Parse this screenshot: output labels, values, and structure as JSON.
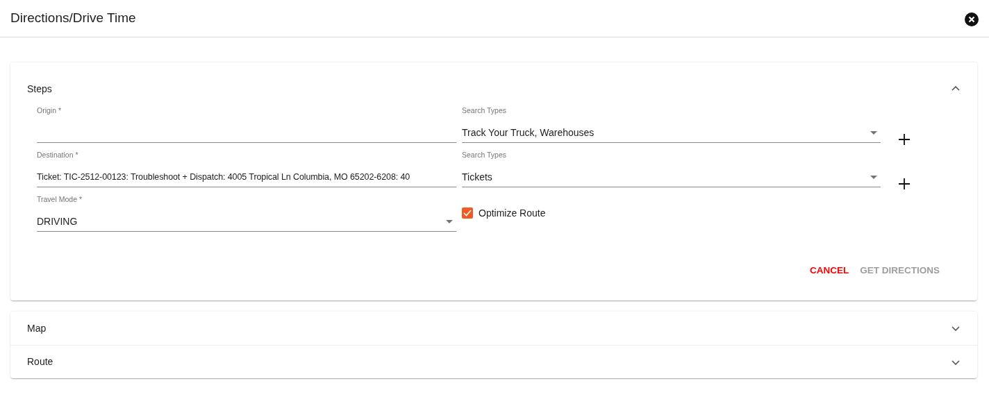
{
  "dialog": {
    "title": "Directions/Drive Time"
  },
  "panels": [
    {
      "title": "Steps",
      "expanded": true,
      "rows": [
        {
          "field": {
            "kind": "text",
            "label": "Origin *"
          },
          "side": {
            "kind": "select",
            "label": "Search Types",
            "value": "Track Your Truck, Warehouses"
          }
        },
        {
          "field": {
            "kind": "text",
            "label": "Destination *",
            "value": "Ticket: TIC-2512-00123: Troubleshoot + Dispatch: 4005 Tropical Ln Columbia, MO 65202-6208: 40"
          },
          "side": {
            "kind": "select",
            "label": "Search Types",
            "value": "Tickets"
          }
        },
        {
          "field": {
            "kind": "select",
            "label": "Travel Mode *",
            "value": "DRIVING"
          },
          "side": {
            "kind": "checkbox",
            "label": "Optimize Route",
            "checked": true
          }
        }
      ],
      "buttons": [
        {
          "label": "CANCEL",
          "kind": "cancel",
          "disabled": false
        },
        {
          "label": "GET DIRECTIONS",
          "kind": "primary",
          "disabled": true
        }
      ]
    },
    {
      "title": "Map",
      "expanded": false
    },
    {
      "title": "Route",
      "expanded": false
    }
  ]
}
